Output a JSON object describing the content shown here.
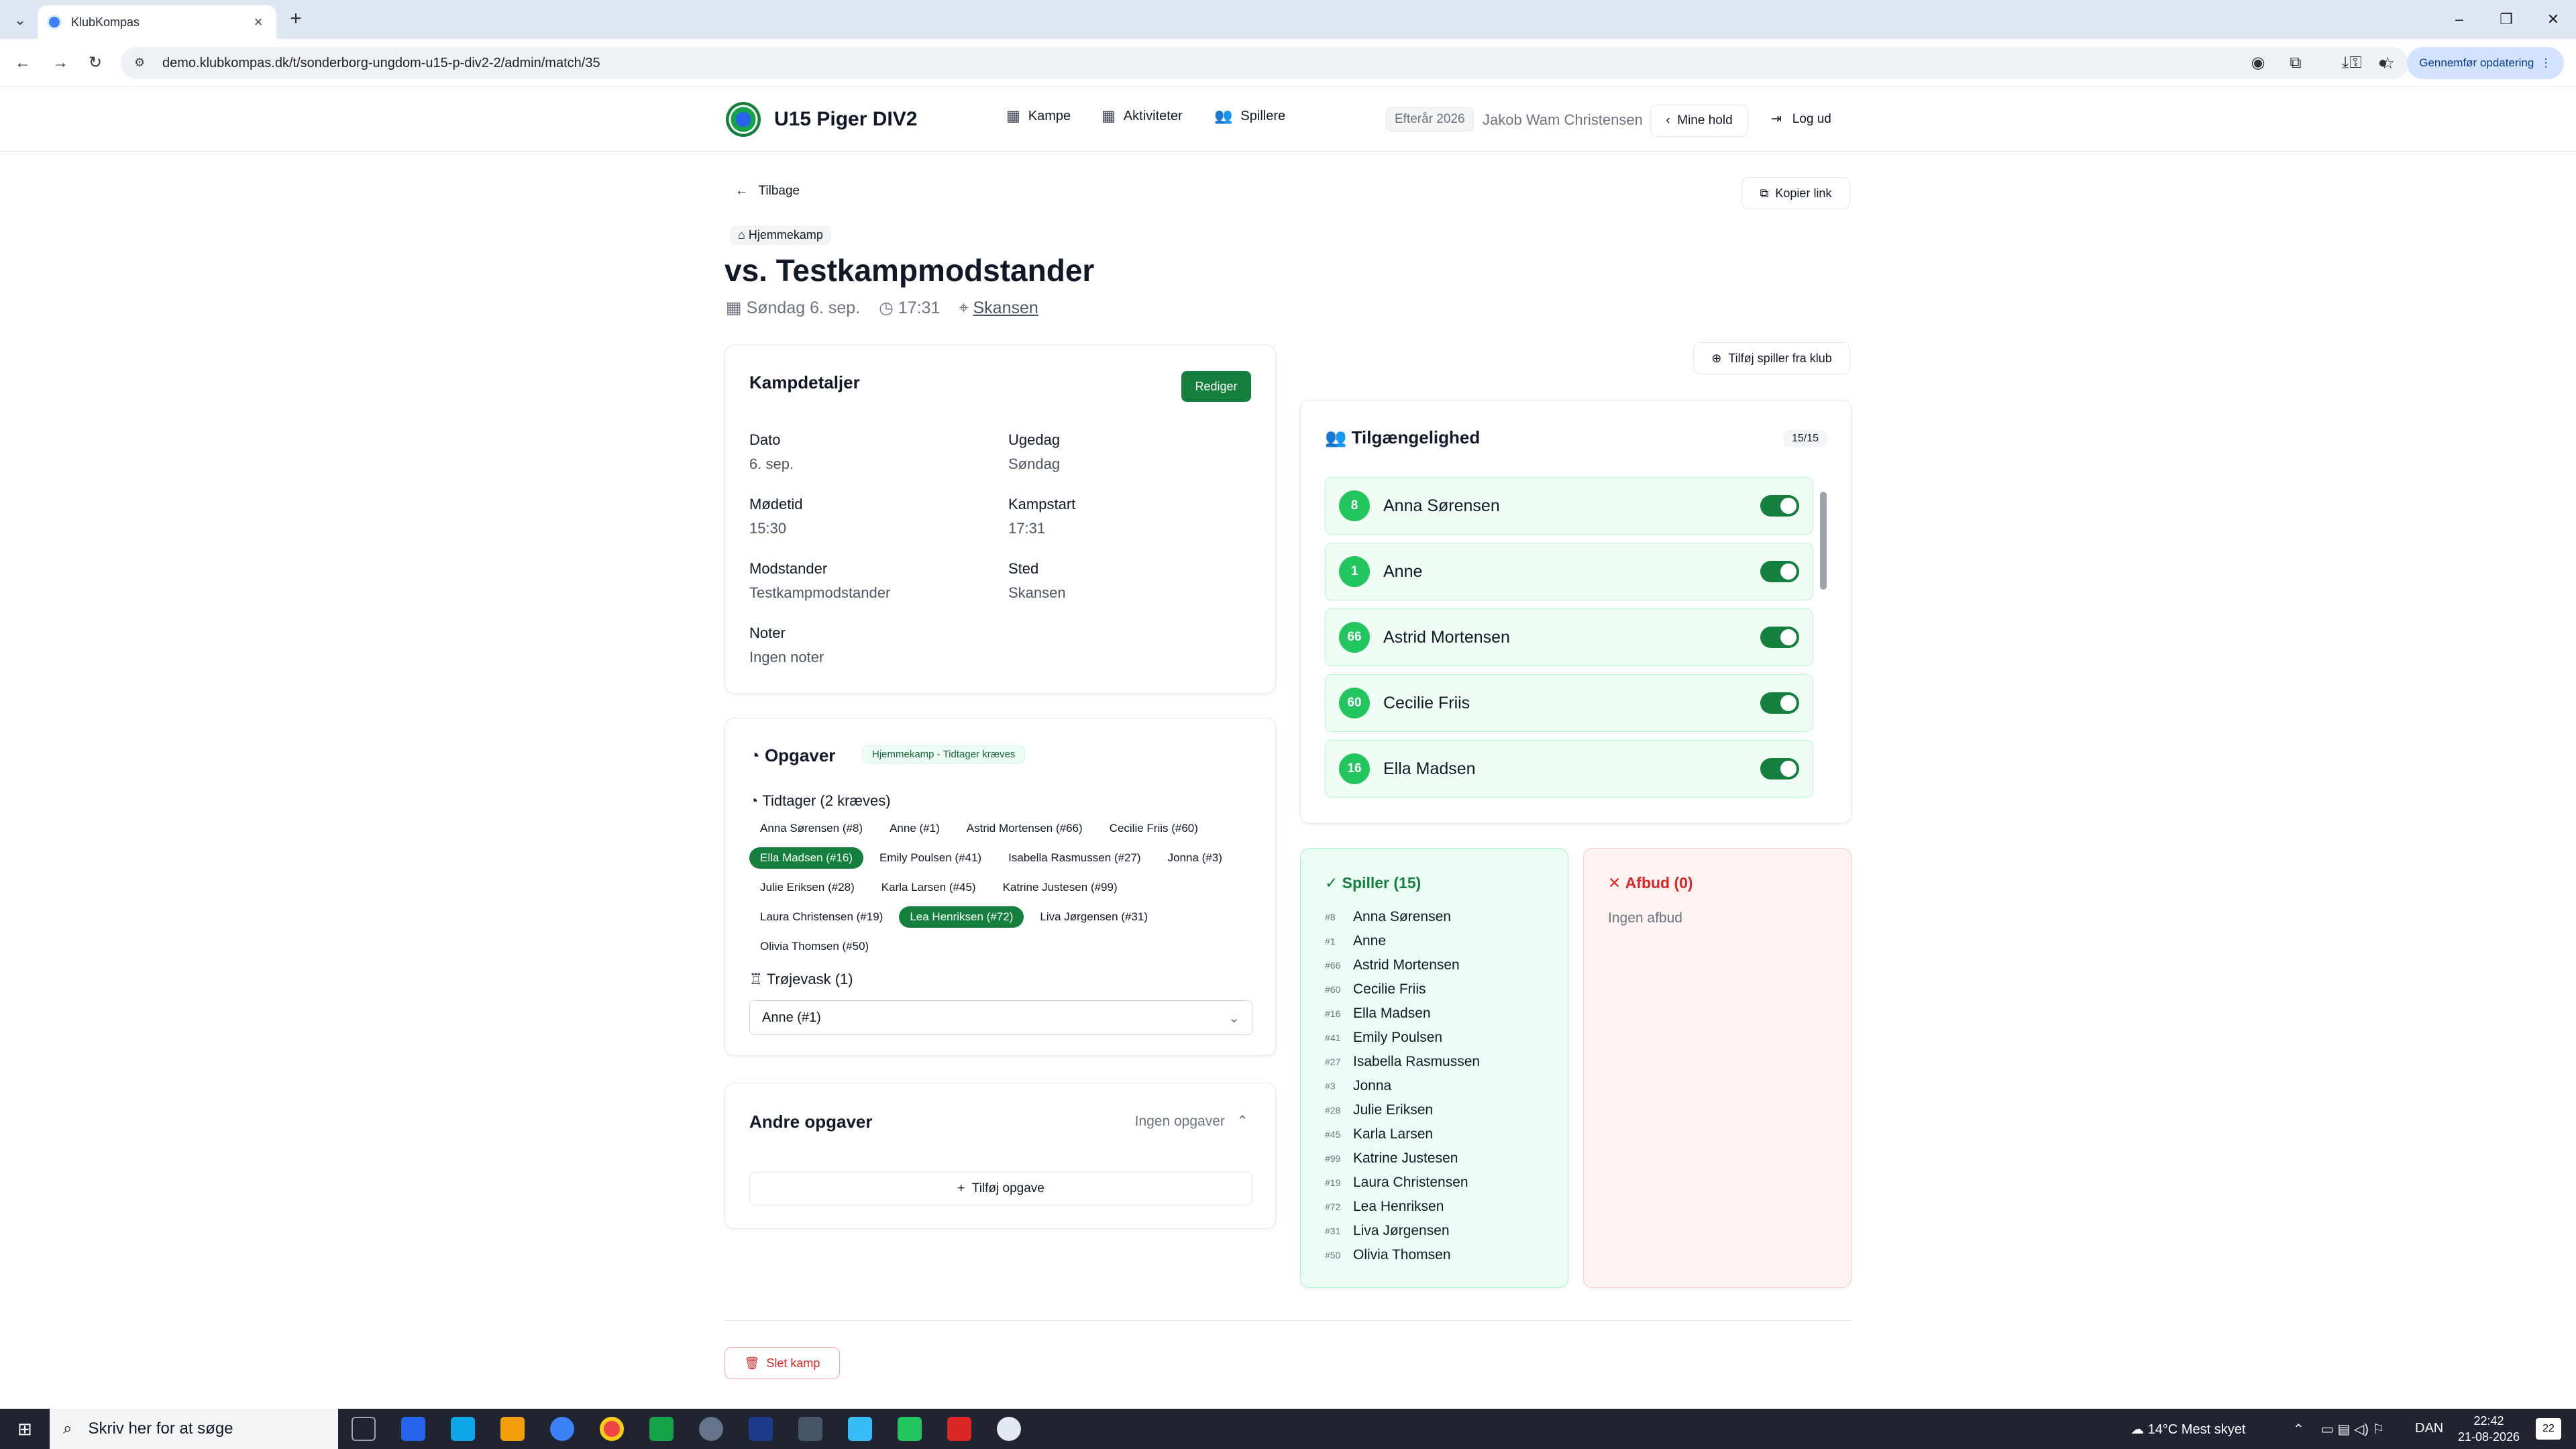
{
  "browser": {
    "tab_title": "KlubKompas",
    "url": "demo.klubkompas.dk/t/sonderborg-ungdom-u15-p-div2-2/admin/match/35",
    "update_label": "Gennemfør opdatering"
  },
  "header": {
    "team_title": "U15 Piger DIV2",
    "nav": {
      "matches": "Kampe",
      "activities": "Aktiviteter",
      "players": "Spillere"
    },
    "season": "Efterår 2026",
    "user": "Jakob Wam Christensen",
    "my_teams": "Mine hold",
    "logout": "Log ud"
  },
  "page": {
    "back": "Tilbage",
    "copy_link": "Kopier link",
    "home_chip": "Hjemmekamp",
    "title": "vs. Testkampmodstander",
    "date": "Søndag 6. sep.",
    "time": "17:31",
    "location": "Skansen",
    "add_player": "Tilføj spiller fra klub",
    "delete": "Slet kamp"
  },
  "details": {
    "title": "Kampdetaljer",
    "edit": "Rediger",
    "dato_label": "Dato",
    "dato": "6. sep.",
    "ugedag_label": "Ugedag",
    "ugedag": "Søndag",
    "modetid_label": "Mødetid",
    "modetid": "15:30",
    "kampstart_label": "Kampstart",
    "kampstart": "17:31",
    "modstander_label": "Modstander",
    "modstander": "Testkampmodstander",
    "sted_label": "Sted",
    "sted": "Skansen",
    "noter_label": "Noter",
    "noter": "Ingen noter"
  },
  "tasks": {
    "title": "Opgaver",
    "badge": "Hjemmekamp - Tidtager kræves",
    "timekeeper": "Tidtager (2 kræves)",
    "chips": [
      {
        "label": "Anna Sørensen (#8)",
        "selected": false
      },
      {
        "label": "Anne (#1)",
        "selected": false
      },
      {
        "label": "Astrid Mortensen (#66)",
        "selected": false
      },
      {
        "label": "Cecilie Friis (#60)",
        "selected": false
      },
      {
        "label": "Ella Madsen (#16)",
        "selected": true
      },
      {
        "label": "Emily Poulsen (#41)",
        "selected": false
      },
      {
        "label": "Isabella Rasmussen (#27)",
        "selected": false
      },
      {
        "label": "Jonna (#3)",
        "selected": false
      },
      {
        "label": "Julie Eriksen (#28)",
        "selected": false
      },
      {
        "label": "Karla Larsen (#45)",
        "selected": false
      },
      {
        "label": "Katrine Justesen (#99)",
        "selected": false
      },
      {
        "label": "Laura Christensen (#19)",
        "selected": false
      },
      {
        "label": "Lea Henriksen (#72)",
        "selected": true
      },
      {
        "label": "Liva Jørgensen (#31)",
        "selected": false
      },
      {
        "label": "Olivia Thomsen (#50)",
        "selected": false
      }
    ],
    "jersey": "Trøjevask (1)",
    "jersey_value": "Anne (#1)"
  },
  "other_tasks": {
    "title": "Andre opgaver",
    "status": "Ingen opgaver",
    "add": "Tilføj opgave"
  },
  "availability": {
    "title": "Tilgængelighed",
    "count": "15/15",
    "players": [
      {
        "num": "8",
        "name": "Anna Sørensen"
      },
      {
        "num": "1",
        "name": "Anne"
      },
      {
        "num": "66",
        "name": "Astrid Mortensen"
      },
      {
        "num": "60",
        "name": "Cecilie Friis"
      },
      {
        "num": "16",
        "name": "Ella Madsen"
      }
    ]
  },
  "roster": {
    "title": "Spiller (15)",
    "players": [
      {
        "num": "#8",
        "name": "Anna Sørensen"
      },
      {
        "num": "#1",
        "name": "Anne"
      },
      {
        "num": "#66",
        "name": "Astrid Mortensen"
      },
      {
        "num": "#60",
        "name": "Cecilie Friis"
      },
      {
        "num": "#16",
        "name": "Ella Madsen"
      },
      {
        "num": "#41",
        "name": "Emily Poulsen"
      },
      {
        "num": "#27",
        "name": "Isabella Rasmussen"
      },
      {
        "num": "#3",
        "name": "Jonna"
      },
      {
        "num": "#28",
        "name": "Julie Eriksen"
      },
      {
        "num": "#45",
        "name": "Karla Larsen"
      },
      {
        "num": "#99",
        "name": "Katrine Justesen"
      },
      {
        "num": "#19",
        "name": "Laura Christensen"
      },
      {
        "num": "#72",
        "name": "Lea Henriksen"
      },
      {
        "num": "#31",
        "name": "Liva Jørgensen"
      },
      {
        "num": "#50",
        "name": "Olivia Thomsen"
      }
    ]
  },
  "absent": {
    "title": "Afbud (0)",
    "empty": "Ingen afbud"
  },
  "taskbar": {
    "search_placeholder": "Skriv her for at søge",
    "weather": "14°C  Mest skyet",
    "lang": "DAN",
    "time": "22:42",
    "date": "21-08-2026",
    "notif_count": "22"
  },
  "colors": {
    "accent": "#15803d",
    "available_bg": "#f0fdf4",
    "absent": "#dc2626"
  }
}
